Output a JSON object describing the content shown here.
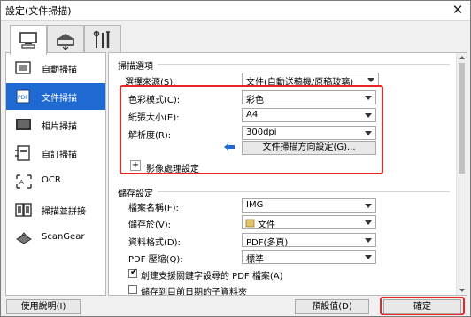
{
  "window": {
    "title": "設定(文件掃描)"
  },
  "toptabs": [
    {
      "icon": "scanner-computer-icon"
    },
    {
      "icon": "scanner-icon"
    },
    {
      "icon": "tools-icon"
    }
  ],
  "sidebar": {
    "items": [
      {
        "label": "自動掃描",
        "icon": "auto-scan-icon"
      },
      {
        "label": "文件掃描",
        "icon": "document-scan-icon",
        "active": true
      },
      {
        "label": "相片掃描",
        "icon": "photo-scan-icon"
      },
      {
        "label": "自訂掃描",
        "icon": "custom-scan-icon"
      },
      {
        "label": "OCR",
        "icon": "ocr-icon"
      },
      {
        "label": "掃描並拼接",
        "icon": "stitch-icon"
      },
      {
        "label": "ScanGear",
        "icon": "scangear-icon"
      }
    ]
  },
  "scan_options": {
    "title": "掃描選項",
    "source_label": "選擇來源(S):",
    "source_value": "文件(自動送稿機/原稿玻璃)",
    "color_label": "色彩模式(C):",
    "color_value": "彩色",
    "paper_label": "紙張大小(E):",
    "paper_value": "A4",
    "res_label": "解析度(R):",
    "res_value": "300dpi",
    "doc_settings_button": "文件掃描方向設定(G)...",
    "image_processing_label": "影像處理設定",
    "expand_symbol": "+"
  },
  "save_settings": {
    "title": "儲存設定",
    "filename_label": "檔案名稱(F):",
    "filename_value": "IMG",
    "savein_label": "儲存於(V):",
    "savein_value": "文件",
    "format_label": "資料格式(D):",
    "format_value": "PDF(多頁)",
    "compress_label": "PDF 壓縮(Q):",
    "compress_value": "標準",
    "keyword_checkbox": "創建支援關鍵字設尋的 PDF 檔案(A)",
    "keyword_checked": true,
    "subfolder_checkbox": "儲存到目前日期的子資料夾",
    "subfolder_checked": false
  },
  "footer": {
    "help_button": "使用說明(I)",
    "defaults_button": "預設值(D)",
    "ok_button": "確定"
  },
  "colors": {
    "accent": "#1e69d2",
    "highlight": "#e8262a"
  }
}
